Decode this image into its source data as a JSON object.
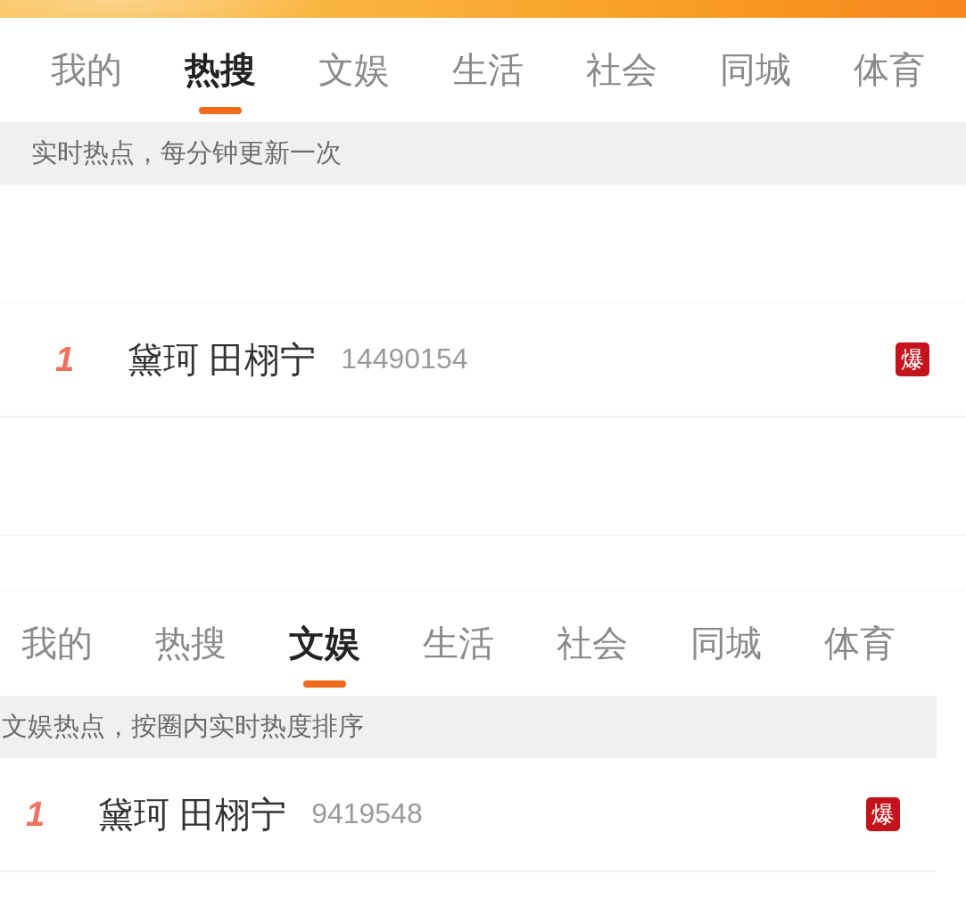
{
  "panels": [
    {
      "tabs": [
        {
          "label": "我的",
          "selected": false
        },
        {
          "label": "热搜",
          "selected": true
        },
        {
          "label": "文娱",
          "selected": false
        },
        {
          "label": "生活",
          "selected": false
        },
        {
          "label": "社会",
          "selected": false
        },
        {
          "label": "同城",
          "selected": false
        },
        {
          "label": "体育",
          "selected": false
        }
      ],
      "notice": "实时热点，每分钟更新一次",
      "rows": [
        {
          "rank": "1",
          "title": "黛珂 田栩宁",
          "heat": "14490154",
          "badge": "爆"
        }
      ]
    },
    {
      "tabs": [
        {
          "label": "我的",
          "selected": false
        },
        {
          "label": "热搜",
          "selected": false
        },
        {
          "label": "文娱",
          "selected": true
        },
        {
          "label": "生活",
          "selected": false
        },
        {
          "label": "社会",
          "selected": false
        },
        {
          "label": "同城",
          "selected": false
        },
        {
          "label": "体育",
          "selected": false
        }
      ],
      "notice": "文娱热点，按圈内实时热度排序",
      "rows": [
        {
          "rank": "1",
          "title": "黛珂 田栩宁",
          "heat": "9419548",
          "badge": "爆"
        }
      ]
    }
  ]
}
